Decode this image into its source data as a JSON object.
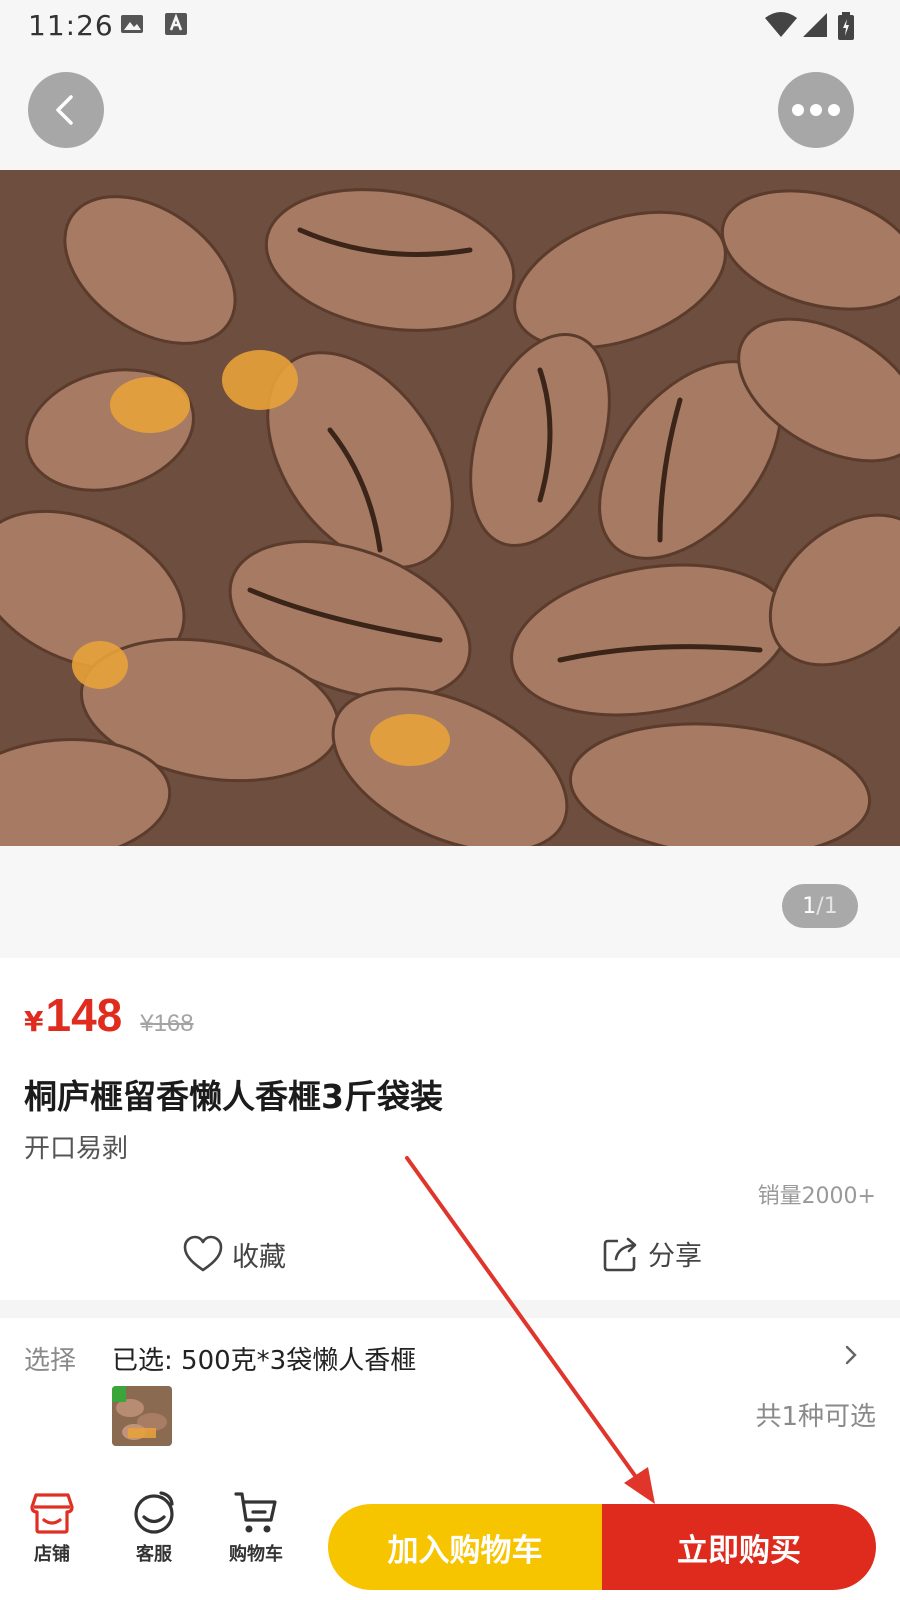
{
  "status_bar": {
    "time": "11:26"
  },
  "topbar": {
    "back_icon": "chevron-left-icon",
    "more_icon": "more-dots-icon"
  },
  "gallery": {
    "current": "1",
    "separator": "/",
    "total": "1"
  },
  "price": {
    "symbol": "¥",
    "current": "148",
    "original": "¥168"
  },
  "product": {
    "title": "桐庐榧留香懒人香榧3斤袋装",
    "subtitle": "开口易剥",
    "sales": "销量2000+"
  },
  "actions": {
    "favorite": "收藏",
    "share": "分享"
  },
  "selection": {
    "label": "选择",
    "value": "已选: 500克*3袋懒人香榧",
    "count": "共1种可选"
  },
  "bottom_nav": [
    {
      "label": "店铺",
      "icon": "store-icon"
    },
    {
      "label": "客服",
      "icon": "customer-service-icon"
    },
    {
      "label": "购物车",
      "icon": "cart-icon"
    }
  ],
  "buttons": {
    "add_to_cart": "加入购物车",
    "buy_now": "立即购买"
  },
  "colors": {
    "accent_red": "#df2b1e",
    "cart_yellow": "#f7c400",
    "annotation_arrow": "#e0352b"
  }
}
